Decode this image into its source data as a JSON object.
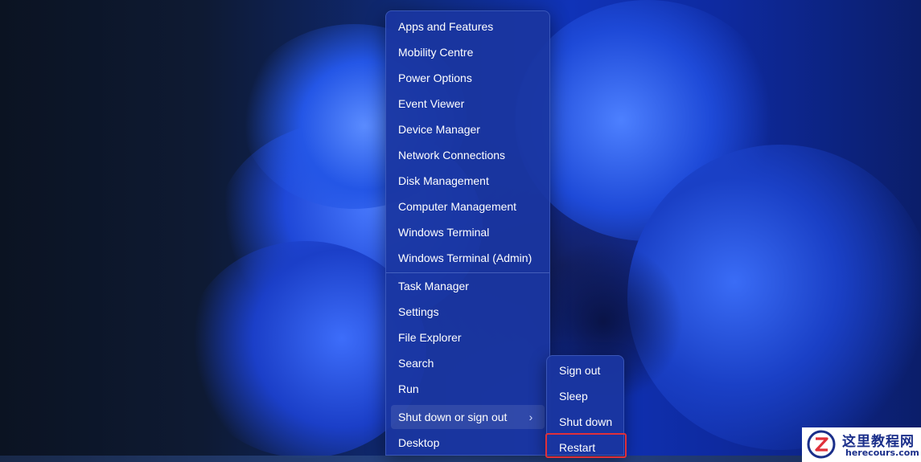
{
  "menu": {
    "items": [
      {
        "label": "Apps and Features"
      },
      {
        "label": "Mobility Centre"
      },
      {
        "label": "Power Options"
      },
      {
        "label": "Event Viewer"
      },
      {
        "label": "Device Manager"
      },
      {
        "label": "Network Connections"
      },
      {
        "label": "Disk Management"
      },
      {
        "label": "Computer Management"
      },
      {
        "label": "Windows Terminal"
      },
      {
        "label": "Windows Terminal (Admin)"
      },
      {
        "label": "Task Manager"
      },
      {
        "label": "Settings"
      },
      {
        "label": "File Explorer"
      },
      {
        "label": "Search"
      },
      {
        "label": "Run"
      },
      {
        "label": "Shut down or sign out"
      },
      {
        "label": "Desktop"
      }
    ],
    "chevron_glyph": "›"
  },
  "submenu": {
    "items": [
      {
        "label": "Sign out"
      },
      {
        "label": "Sleep"
      },
      {
        "label": "Shut down"
      },
      {
        "label": "Restart"
      }
    ]
  },
  "watermark": {
    "title": "这里教程网",
    "url": "herecours.com",
    "logo_letter": "Z"
  },
  "colors": {
    "menu_bg": "#1a36a0",
    "highlight_outline": "#e0303a",
    "watermark_text": "#1b2f8a"
  }
}
